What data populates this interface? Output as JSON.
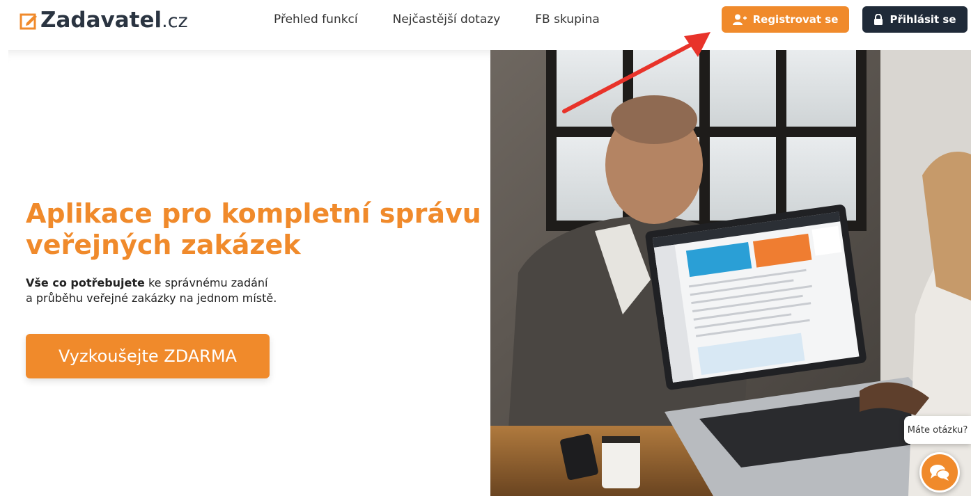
{
  "brand": {
    "name": "Zadavatel",
    "tld": ".cz",
    "accent_color": "#f08a2b",
    "dark_color": "#1f2a38"
  },
  "nav": {
    "items": [
      {
        "label": "Přehled funkcí"
      },
      {
        "label": "Nejčastější dotazy"
      },
      {
        "label": "FB skupina"
      }
    ]
  },
  "auth": {
    "register_label": "Registrovat se",
    "register_icon": "user-plus-icon",
    "login_label": "Přihlásit se",
    "login_icon": "lock-icon"
  },
  "hero": {
    "title": "Aplikace pro kompletní správu veřejných zakázek",
    "subtitle_bold": "Vše co potřebujete",
    "subtitle_rest_line1": " ke správnému zadání",
    "subtitle_line2": "a průběhu veřejné zakázky na jednom místě.",
    "cta_label": "Vyzkoušejte ZDARMA"
  },
  "chat": {
    "prompt": "Máte otázku?",
    "icon": "chat-bubbles-icon"
  }
}
